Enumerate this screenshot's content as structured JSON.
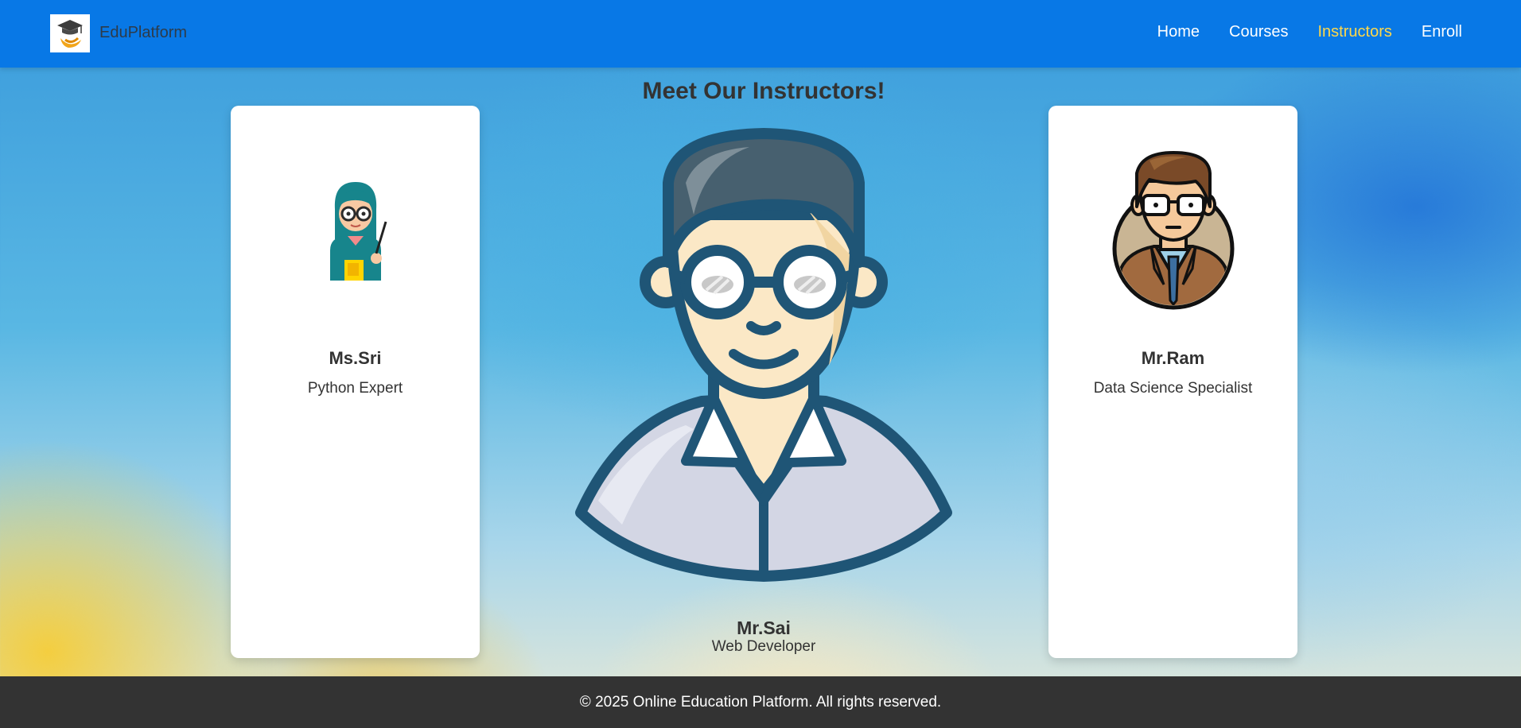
{
  "header": {
    "brand": "EduPlatform",
    "logo_icon": "graduation-cap-icon",
    "nav": [
      {
        "label": "Home",
        "active": false
      },
      {
        "label": "Courses",
        "active": false
      },
      {
        "label": "Instructors",
        "active": true
      },
      {
        "label": "Enroll",
        "active": false
      }
    ],
    "colors": {
      "bar": "#0878e6",
      "active_link": "#ffd84a"
    }
  },
  "main": {
    "title": "Meet Our Instructors!",
    "instructors": [
      {
        "name": "Ms.Sri",
        "role": "Python Expert",
        "avatar_icon": "teacher-woman-icon"
      },
      {
        "name": "Mr.Sai",
        "role": "Web Developer",
        "avatar_icon": "man-with-glasses-icon"
      },
      {
        "name": "Mr.Ram",
        "role": "Data Science Specialist",
        "avatar_icon": "man-in-suit-icon"
      }
    ]
  },
  "footer": {
    "text": "© 2025 Online Education Platform. All rights reserved."
  }
}
